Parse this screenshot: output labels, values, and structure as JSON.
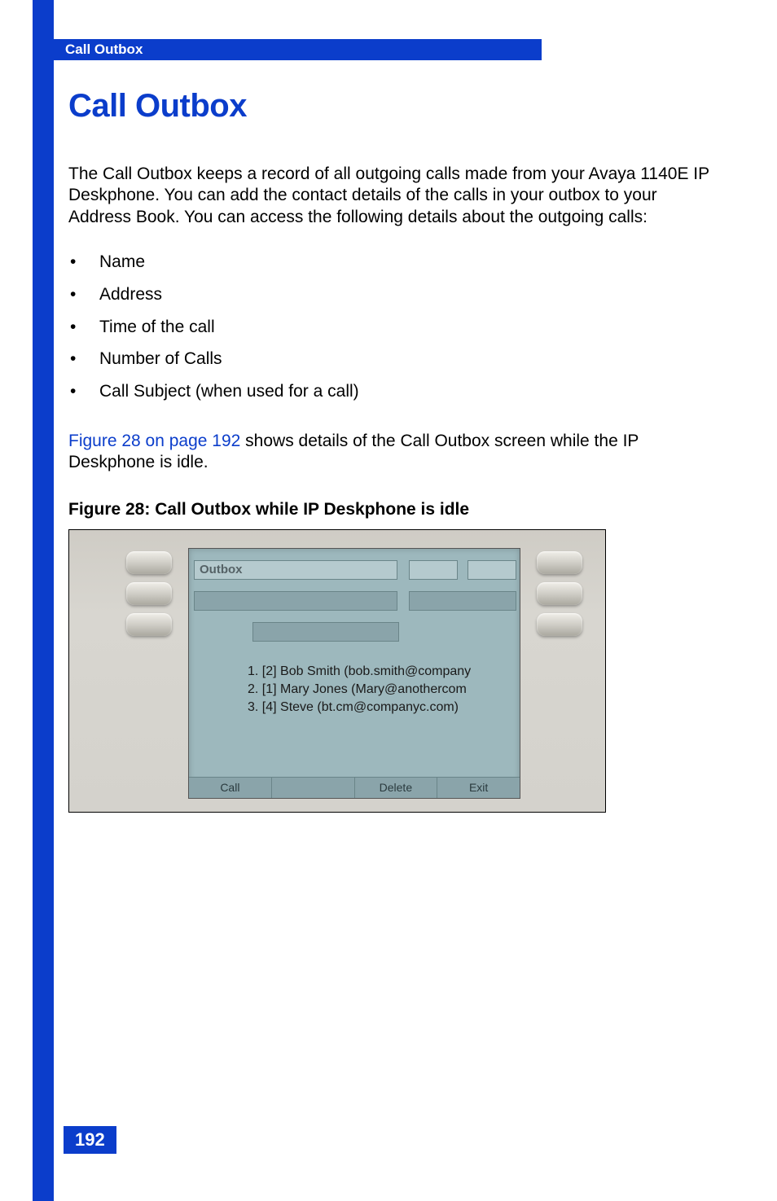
{
  "header": {
    "running_title": "Call Outbox"
  },
  "page": {
    "title": "Call Outbox",
    "intro": "The Call Outbox keeps a record of all outgoing calls made from your Avaya 1140E IP Deskphone. You can add the contact details of the calls in your outbox to your Address Book. You can access the following details about the outgoing calls:",
    "bullets": [
      "Name",
      "Address",
      "Time of the call",
      "Number of Calls",
      "Call Subject (when used for a call)"
    ],
    "figure_ref_link": "Figure 28 on page 192",
    "figure_ref_rest": " shows details of the Call Outbox screen while the IP Deskphone is idle.",
    "figure_caption": "Figure 28: Call Outbox while IP Deskphone is idle",
    "page_number": "192"
  },
  "screenshot": {
    "title": "Outbox",
    "entries": [
      "1. [2] Bob Smith (bob.smith@company",
      "2. [1] Mary Jones (Mary@anothercom",
      "3. [4] Steve (bt.cm@companyc.com)"
    ],
    "softkeys": {
      "k1": "Call",
      "k2": "",
      "k3": "Delete",
      "k4": "Exit"
    }
  }
}
